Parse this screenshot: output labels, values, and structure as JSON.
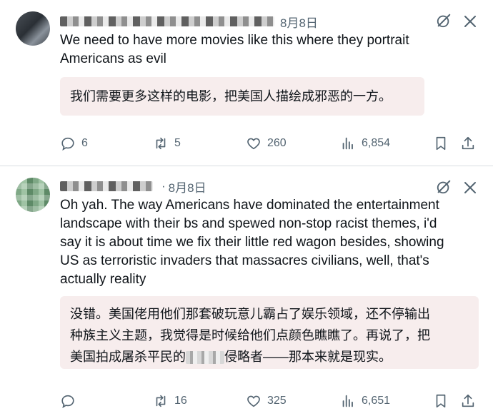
{
  "posts": [
    {
      "date": "8月8日",
      "text": "We need to have more movies like this where they portrait\nAmericans as evil",
      "translation": "我们需要更多这样的电影，把美国人描绘成邪恶的一方。",
      "stats": {
        "replies": "6",
        "reposts": "5",
        "likes": "260",
        "views": "6,854"
      },
      "icons": {
        "grok": "grok-icon",
        "more": "more-icon",
        "reply": "reply-icon",
        "repost": "repost-icon",
        "like": "heart-icon",
        "views": "views-icon",
        "bookmark": "bookmark-icon",
        "share": "share-icon"
      }
    },
    {
      "separator": "·",
      "date": "8月8日",
      "text": "Oh yah. The way Americans have dominated the entertainment\nlandscape with their bs and spewed non-stop racist themes, i'd\nsay it is about time we fix their little red wagon besides, showing\nUS as terroristic invaders that massacres civilians, well, that's\nactually reality",
      "translation_line1": "没错。美国佬用他们那套破玩意儿霸占了娱乐领域，还不停输出",
      "translation_line2": "种族主义主题，我觉得是时候给他们点颜色瞧瞧了。再说了，把",
      "translation_line3a": "美国拍成屠杀平民的",
      "translation_line3b": "侵略者——那本来就是现实。",
      "stats": {
        "replies": "",
        "reposts": "16",
        "likes": "325",
        "views": "6,651"
      }
    }
  ],
  "colors": {
    "text": "#0f1419",
    "secondary": "#536471",
    "translation_bg": "#f7eded",
    "divider": "#d9dde1"
  }
}
